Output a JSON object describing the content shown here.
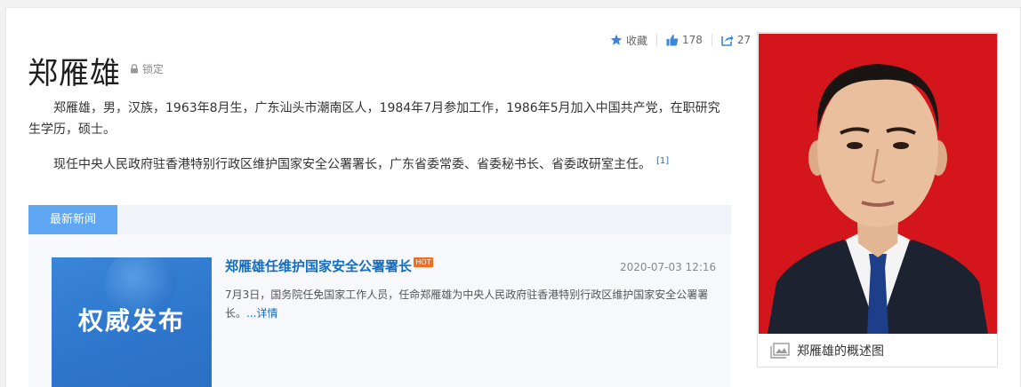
{
  "entry": {
    "title": "郑雁雄",
    "lock_label": "锁定",
    "paragraphs": [
      "郑雁雄，男，汉族，1963年8月生，广东汕头市潮南区人，1984年7月参加工作，1986年5月加入中国共产党，在职研究生学历，硕士。",
      "现任中央人民政府驻香港特别行政区维护国家安全公署署长，广东省委常委、省委秘书长、省委政研室主任。"
    ],
    "ref": "[1]"
  },
  "actions": {
    "favorite_label": "收藏",
    "like_count": "178",
    "share_count": "27",
    "favorite_icon": "star-icon",
    "like_icon": "thumbs-up-icon",
    "share_icon": "share-icon"
  },
  "news": {
    "tab_label": "最新新闻",
    "items": [
      {
        "thumb_text": "权威发布",
        "headline": "郑雁雄任维护国家安全公署署长",
        "badge": "HOT",
        "date": "2020-07-03 12:16",
        "summary": "7月3日，国务院任免国家工作人员，任命郑雁雄为中央人民政府驻香港特别行政区维护国家安全公署署长。",
        "more_label": "...详情"
      }
    ]
  },
  "photo": {
    "caption": "郑雁雄的概述图",
    "background_color": "#d4161c"
  },
  "colors": {
    "link": "#136ec2",
    "tab": "#5fa6f3",
    "hot": "#f26d22"
  }
}
